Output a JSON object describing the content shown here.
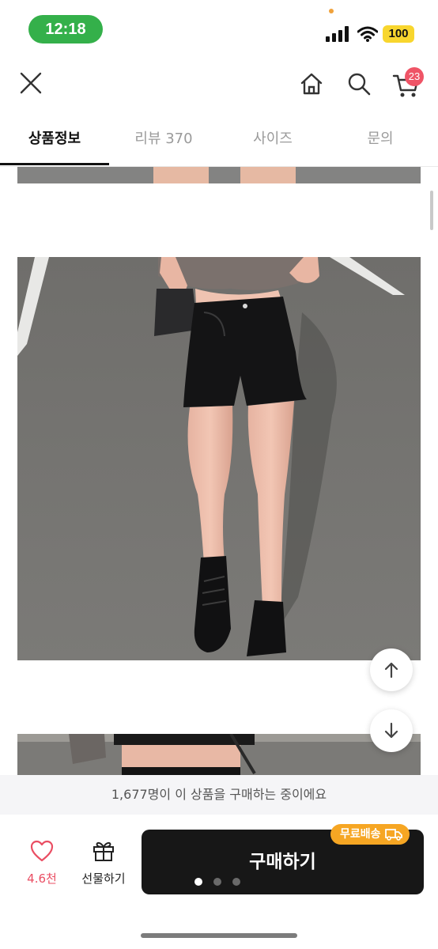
{
  "status_bar": {
    "time": "12:18",
    "battery": "100",
    "time_pill_color": "#34b04a",
    "battery_color": "#f8d62e",
    "icons": [
      "signal-icon",
      "wifi-icon"
    ]
  },
  "header": {
    "icons": [
      "close-icon",
      "home-icon",
      "search-icon",
      "cart-icon"
    ],
    "cart_badge": "23",
    "badge_color": "#ef5466"
  },
  "tabs": [
    {
      "label": "상품정보",
      "active": true
    },
    {
      "label": "리뷰 370",
      "active": false
    },
    {
      "label": "사이즈",
      "active": false
    },
    {
      "label": "문의",
      "active": false
    }
  ],
  "content": {
    "images": [
      "product-photo-partial-top",
      "product-photo-main",
      "product-photo-partial-bottom"
    ],
    "controls": [
      "arrow-up-icon",
      "arrow-down-icon"
    ]
  },
  "social_proof": {
    "text": "1,677명이 이 상품을 구매하는 중이에요"
  },
  "bottom": {
    "like_count": "4.6천",
    "gift_label": "선물하기",
    "buy_label": "구매하기",
    "free_shipping_badge": "무료배송",
    "badge_color": "#f6a623",
    "buy_button_color": "#171717",
    "page_indicator": {
      "active": 1,
      "total": 3
    },
    "icons": [
      "heart-icon",
      "gift-icon",
      "truck-icon"
    ]
  }
}
